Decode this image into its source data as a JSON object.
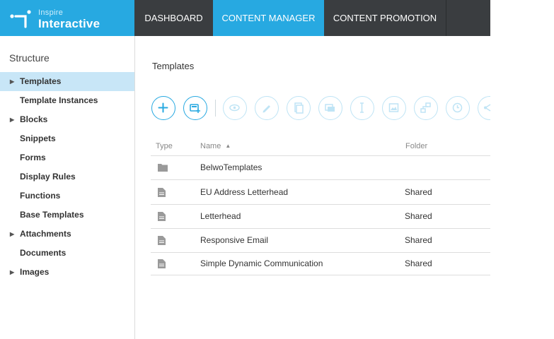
{
  "brand": {
    "line1": "Inspire",
    "line2": "Interactive",
    "accent": "#27a9e1",
    "dark": "#3a3d40"
  },
  "nav": {
    "tabs": [
      {
        "label": "DASHBOARD",
        "active": false
      },
      {
        "label": "CONTENT MANAGER",
        "active": true
      },
      {
        "label": "CONTENT PROMOTION",
        "active": false
      }
    ]
  },
  "sidebar": {
    "title": "Structure",
    "items": [
      {
        "label": "Templates",
        "expandable": true,
        "active": true
      },
      {
        "label": "Template Instances",
        "expandable": false,
        "active": false
      },
      {
        "label": "Blocks",
        "expandable": true,
        "active": false
      },
      {
        "label": "Snippets",
        "expandable": false,
        "active": false
      },
      {
        "label": "Forms",
        "expandable": false,
        "active": false
      },
      {
        "label": "Display Rules",
        "expandable": false,
        "active": false
      },
      {
        "label": "Functions",
        "expandable": false,
        "active": false
      },
      {
        "label": "Base Templates",
        "expandable": false,
        "active": false
      },
      {
        "label": "Attachments",
        "expandable": true,
        "active": false
      },
      {
        "label": "Documents",
        "expandable": false,
        "active": false
      },
      {
        "label": "Images",
        "expandable": true,
        "active": false
      }
    ]
  },
  "main": {
    "title": "Templates",
    "toolbar": [
      {
        "icon": "plus-icon",
        "enabled": true
      },
      {
        "icon": "new-from-template-icon",
        "enabled": true
      },
      {
        "icon": "eye-icon",
        "enabled": false
      },
      {
        "icon": "pencil-icon",
        "enabled": false
      },
      {
        "icon": "copy-icon",
        "enabled": false
      },
      {
        "icon": "move-icon",
        "enabled": false
      },
      {
        "icon": "text-cursor-icon",
        "enabled": false
      },
      {
        "icon": "image-icon",
        "enabled": false
      },
      {
        "icon": "workflow-icon",
        "enabled": false
      },
      {
        "icon": "clock-icon",
        "enabled": false
      },
      {
        "icon": "share-icon",
        "enabled": false
      }
    ],
    "table": {
      "columns": {
        "type": "Type",
        "name": "Name",
        "folder": "Folder"
      },
      "sort": {
        "column": "Name",
        "direction": "ascending"
      },
      "rows": [
        {
          "type": "folder",
          "name": "BelwoTemplates",
          "folder": ""
        },
        {
          "type": "document",
          "name": "EU Address Letterhead",
          "folder": "Shared"
        },
        {
          "type": "document",
          "name": "Letterhead",
          "folder": "Shared"
        },
        {
          "type": "document",
          "name": "Responsive Email",
          "folder": "Shared"
        },
        {
          "type": "document",
          "name": "Simple Dynamic Communication",
          "folder": "Shared"
        }
      ]
    }
  }
}
